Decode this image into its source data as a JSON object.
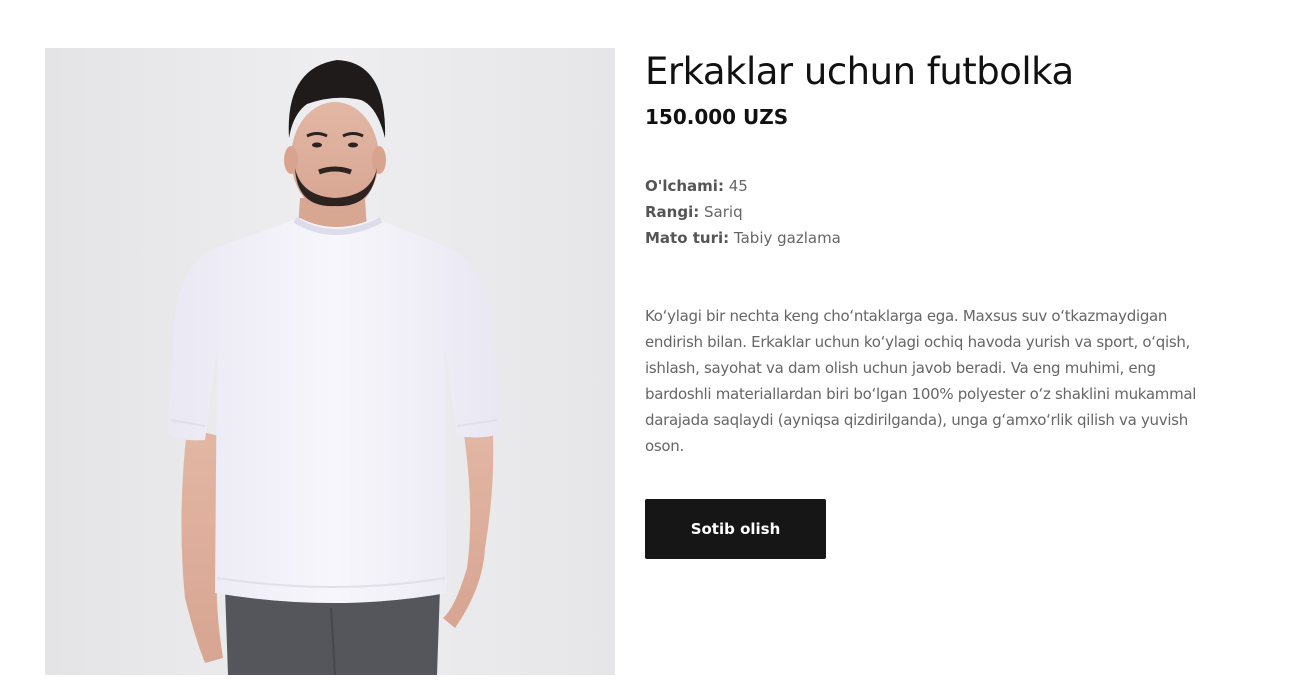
{
  "product": {
    "title": "Erkaklar uchun futbolka",
    "price": "150.000 UZS",
    "image_alt": "Oq futbolka kiygan erkak",
    "specs": [
      {
        "label": "O'lchami:",
        "value": "45"
      },
      {
        "label": "Rangi:",
        "value": "Sariq"
      },
      {
        "label": "Mato turi:",
        "value": "Tabiy gazlama"
      }
    ],
    "description": "Koʻylagi bir nechta keng choʻntaklarga ega. Maxsus suv oʻtkazmaydigan endirish bilan. Erkaklar uchun koʻylagi ochiq havoda yurish va sport, oʻqish, ishlash, sayohat va dam olish uchun javob beradi. Va eng muhimi, eng bardoshli materiallardan biri boʻlgan 100% polyester oʻz shaklini mukammal darajada saqlaydi (ayniqsa qizdirilganda), unga gʻamxoʻrlik qilish va yuvish oson.",
    "buy_label": "Sotib olish"
  },
  "colors": {
    "button_bg": "#161616",
    "button_text": "#ffffff",
    "title": "#111111",
    "body_text": "#666666"
  }
}
